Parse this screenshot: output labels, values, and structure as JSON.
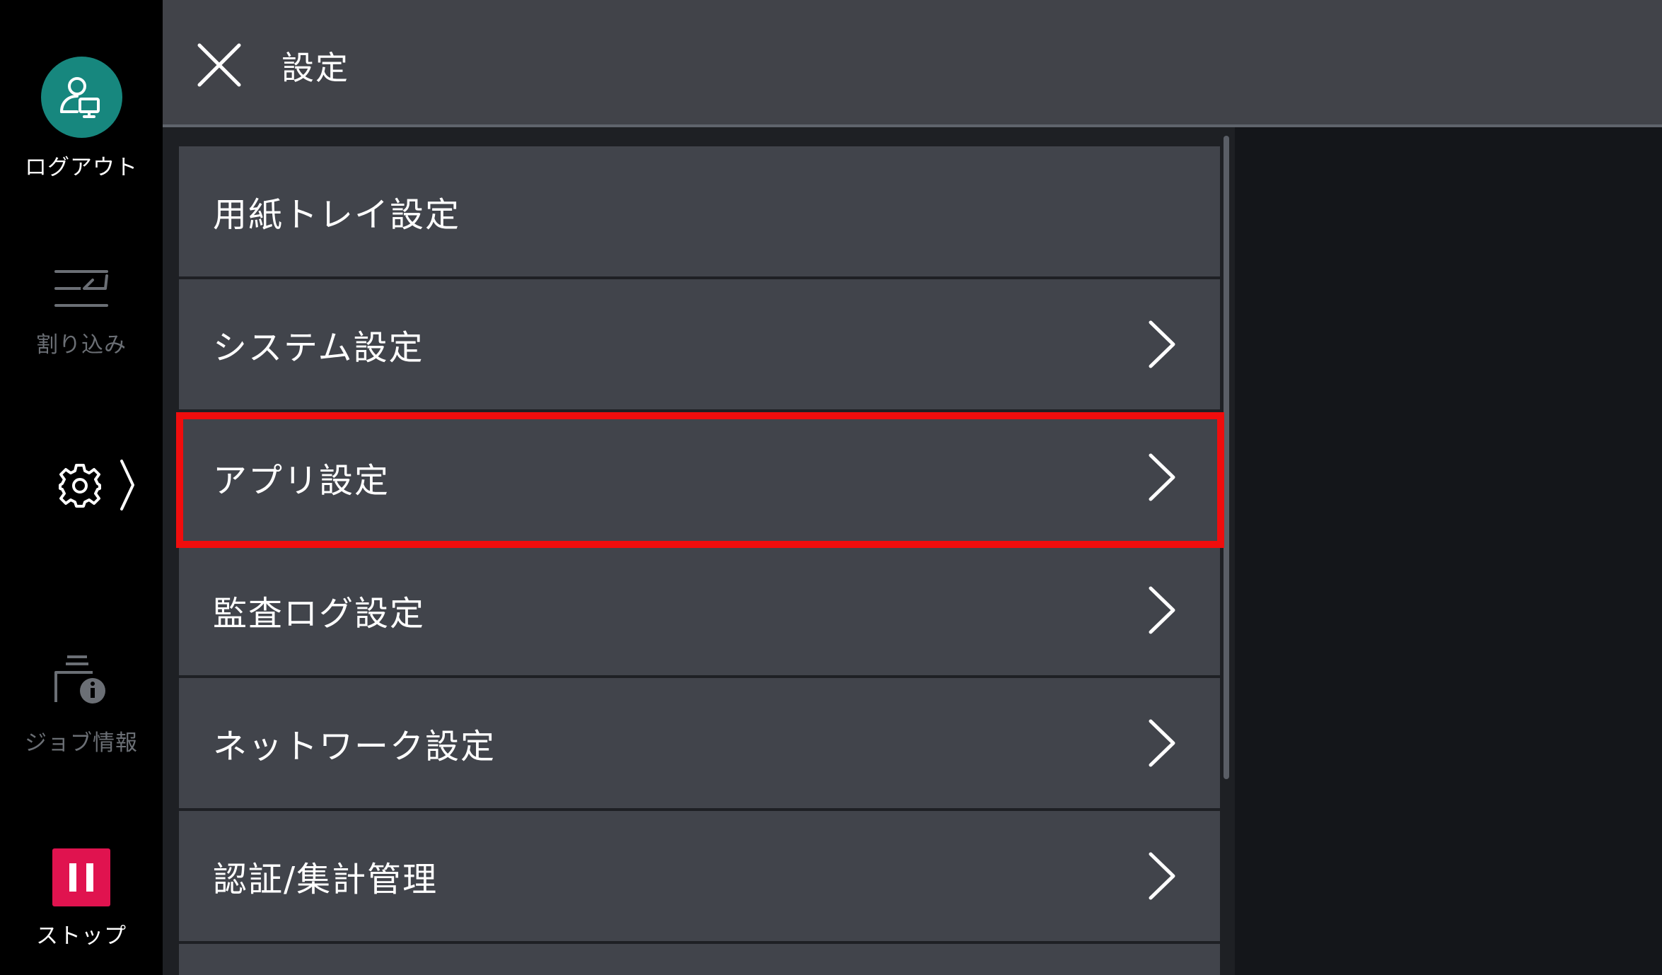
{
  "sidebar": {
    "logout_label": "ログアウト",
    "interrupt_label": "割り込み",
    "jobinfo_label": "ジョブ情報",
    "stop_label": "ストップ"
  },
  "header": {
    "title": "設定"
  },
  "menu": {
    "items": [
      {
        "label": "用紙トレイ設定",
        "has_chevron": false
      },
      {
        "label": "システム設定",
        "has_chevron": true
      },
      {
        "label": "アプリ設定",
        "has_chevron": true,
        "highlighted": true
      },
      {
        "label": "監査ログ設定",
        "has_chevron": true
      },
      {
        "label": "ネットワーク設定",
        "has_chevron": true
      },
      {
        "label": "認証/集計管理",
        "has_chevron": true
      }
    ]
  },
  "colors": {
    "accent_teal": "#17877e",
    "stop_red": "#e0134f",
    "highlight_red": "#f00d0d"
  },
  "icons": {
    "close": "close-icon",
    "avatar": "user-monitor-icon",
    "interrupt": "interrupt-icon",
    "settings": "gear-icon",
    "jobinfo": "printer-info-icon",
    "stop": "pause-icon",
    "chevron": "chevron-right-icon"
  }
}
